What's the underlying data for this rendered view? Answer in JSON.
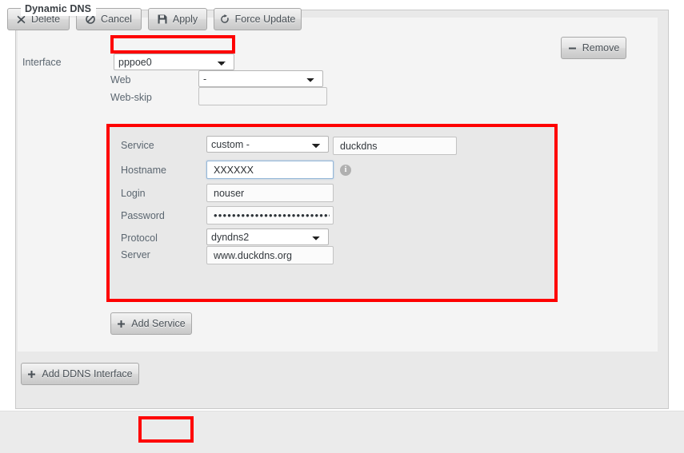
{
  "fieldset": {
    "legend": "Dynamic DNS"
  },
  "interface_section": {
    "interface_label": "Interface",
    "interface_value": "pppoe0",
    "interface_options": [
      "pppoe0"
    ],
    "web_label": "Web",
    "web_value": "-",
    "web_options": [
      "-"
    ],
    "webskip_label": "Web-skip",
    "webskip_value": "",
    "webskip_placeholder": "",
    "remove_button": {
      "label": "Remove",
      "icon": "minus-icon"
    }
  },
  "service_section": {
    "service_label": "Service",
    "service_value": "custom -",
    "service_options": [
      "custom -"
    ],
    "service_name_value": "duckdns",
    "hostname_label": "Hostname",
    "hostname_value": "XXXXXX",
    "hostname_info_icon": "info-icon",
    "login_label": "Login",
    "login_value": "nouser",
    "password_label": "Password",
    "password_value": "••••••••••••••••••••••••••••••••••",
    "protocol_label": "Protocol",
    "protocol_value": "dyndns2",
    "protocol_options": [
      "dyndns2"
    ],
    "server_label": "Server",
    "server_value": "www.duckdns.org",
    "add_service_button": {
      "label": "Add Service",
      "icon": "plus-icon"
    }
  },
  "add_ddns_interface_button": {
    "label": "Add DDNS Interface",
    "icon": "plus-icon"
  },
  "footer": {
    "buttons": [
      {
        "label": "Delete",
        "icon": "times-icon"
      },
      {
        "label": "Cancel",
        "icon": "ban-icon"
      },
      {
        "label": "Apply",
        "icon": "save-icon"
      },
      {
        "label": "Force Update",
        "icon": "refresh-icon"
      }
    ]
  },
  "annotations": {
    "highlight_color": "#fe0000",
    "highlighted": [
      "interface-select",
      "service-block",
      "apply-button"
    ]
  }
}
